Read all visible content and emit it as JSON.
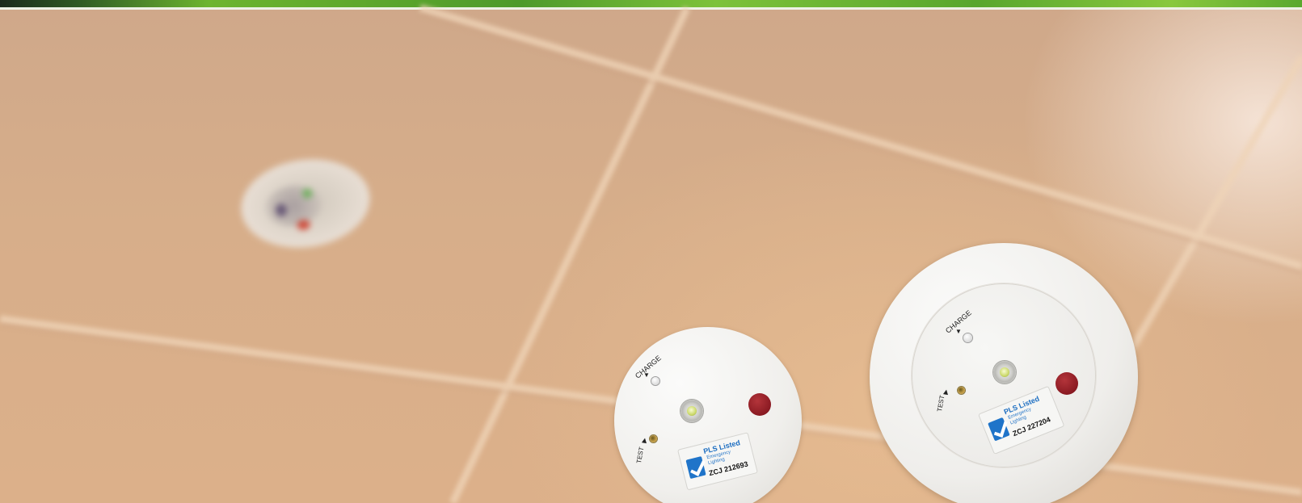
{
  "scene": {
    "description_colors": {
      "ceiling": "#d6ae8c",
      "grid_line": "#efd6bc",
      "brand_bar": "#6db52f",
      "red_button": "#8a1a22",
      "sticker_check": "#1f74c9"
    }
  },
  "small_fixture": {
    "charge_label": "CHARGE",
    "test_label": "TEST",
    "sticker": {
      "title": "PLS Listed",
      "line1": "Emergency",
      "line2": "Lighting",
      "code": "ZCJ 212693"
    }
  },
  "large_fixture": {
    "charge_label": "CHARGE",
    "test_label": "TEST",
    "sticker": {
      "title": "PLS Listed",
      "line1": "Emergency",
      "line2": "Lighting",
      "code": "ZCJ 227204"
    }
  }
}
